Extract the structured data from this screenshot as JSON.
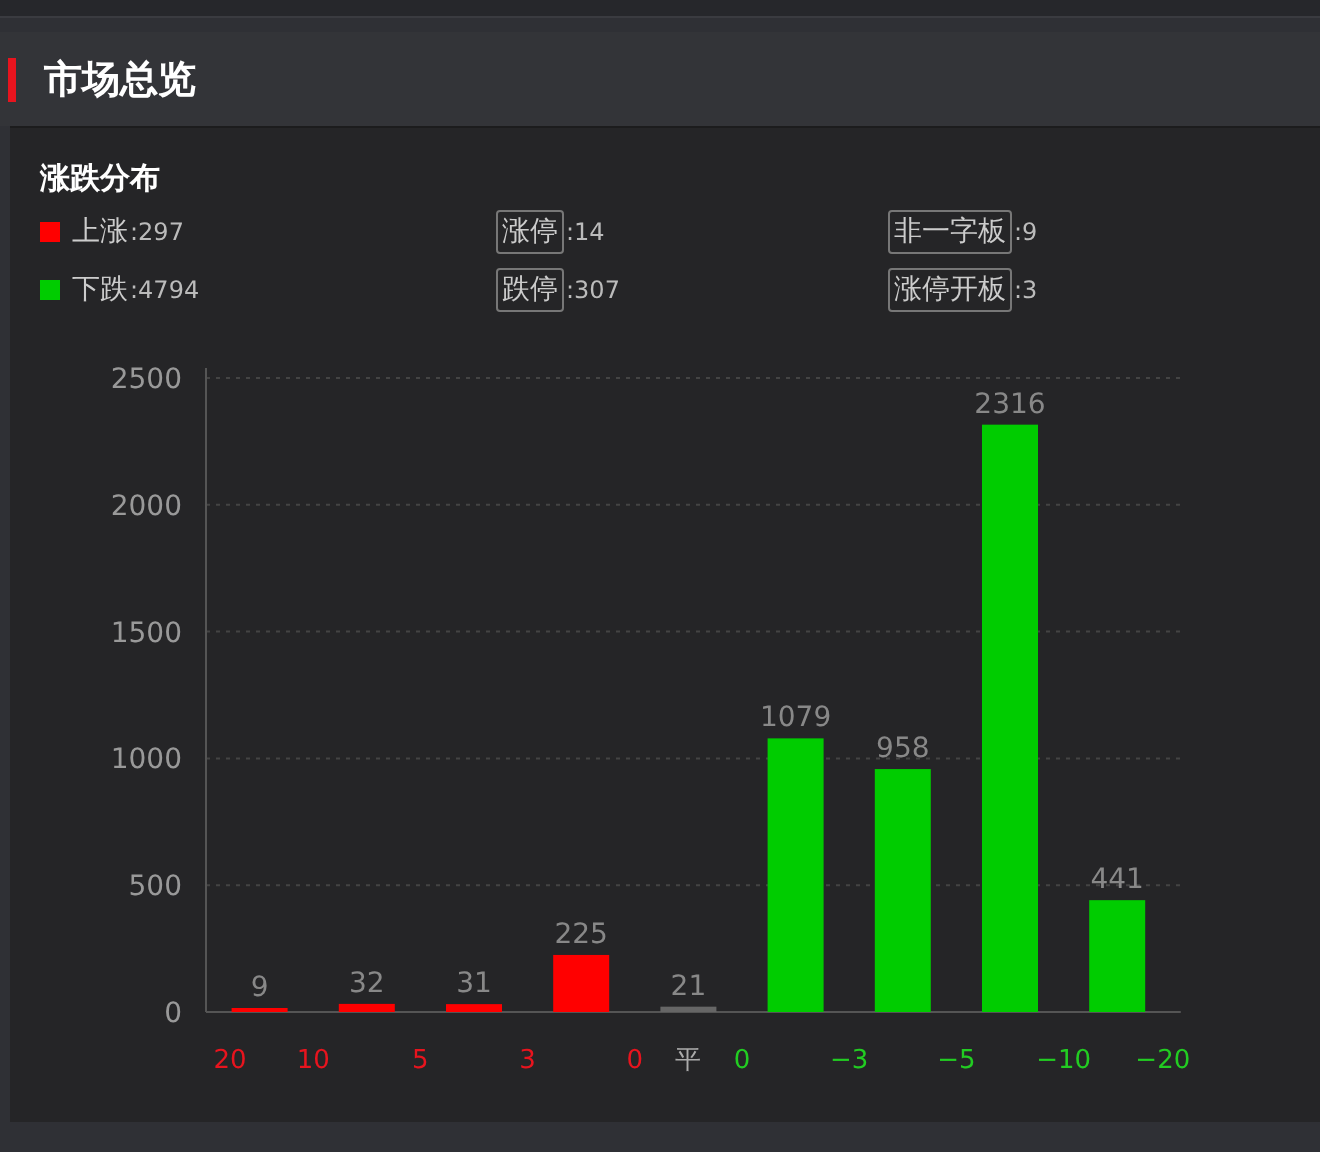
{
  "header": {
    "title": "市场总览"
  },
  "panel": {
    "title": "涨跌分布",
    "stats": [
      {
        "kind": "legend",
        "label": "上涨",
        "value": ":297",
        "color": "#ff0000"
      },
      {
        "kind": "boxed",
        "label": "涨停",
        "value": ":14"
      },
      {
        "kind": "boxed",
        "label": "非一字板",
        "value": ":9"
      },
      {
        "kind": "legend",
        "label": "下跌",
        "value": ":4794",
        "color": "#00cc00"
      },
      {
        "kind": "boxed",
        "label": "跌停",
        "value": ":307"
      },
      {
        "kind": "boxed",
        "label": "涨停开板",
        "value": ":3"
      }
    ],
    "chart_data": {
      "type": "bar",
      "grid": true,
      "data_labels": true,
      "ylim": [
        0,
        2500
      ],
      "yticks": [
        0,
        500,
        1000,
        1500,
        2000,
        2500
      ],
      "series": [
        {
          "color": "#ff0000",
          "values": [
            9,
            32,
            31,
            225,
            null,
            null,
            null,
            null,
            null
          ]
        },
        {
          "color": "#666666",
          "values": [
            null,
            null,
            null,
            null,
            21,
            null,
            null,
            null,
            null
          ]
        },
        {
          "color": "#00cc00",
          "values": [
            null,
            null,
            null,
            null,
            null,
            1079,
            958,
            2316,
            441
          ]
        }
      ]
    },
    "range_labels": [
      {
        "kind": "up",
        "label": "20"
      },
      {
        "kind": "up",
        "label": "10"
      },
      {
        "kind": "up",
        "label": "5"
      },
      {
        "kind": "up",
        "label": "3"
      },
      {
        "kind": "up",
        "label": "0"
      },
      {
        "kind": "flat",
        "label": "平"
      },
      {
        "kind": "down",
        "label": "0"
      },
      {
        "kind": "down",
        "label": "−3"
      },
      {
        "kind": "down",
        "label": "−5"
      },
      {
        "kind": "down",
        "label": "−10"
      },
      {
        "kind": "down",
        "label": "−20"
      }
    ]
  }
}
